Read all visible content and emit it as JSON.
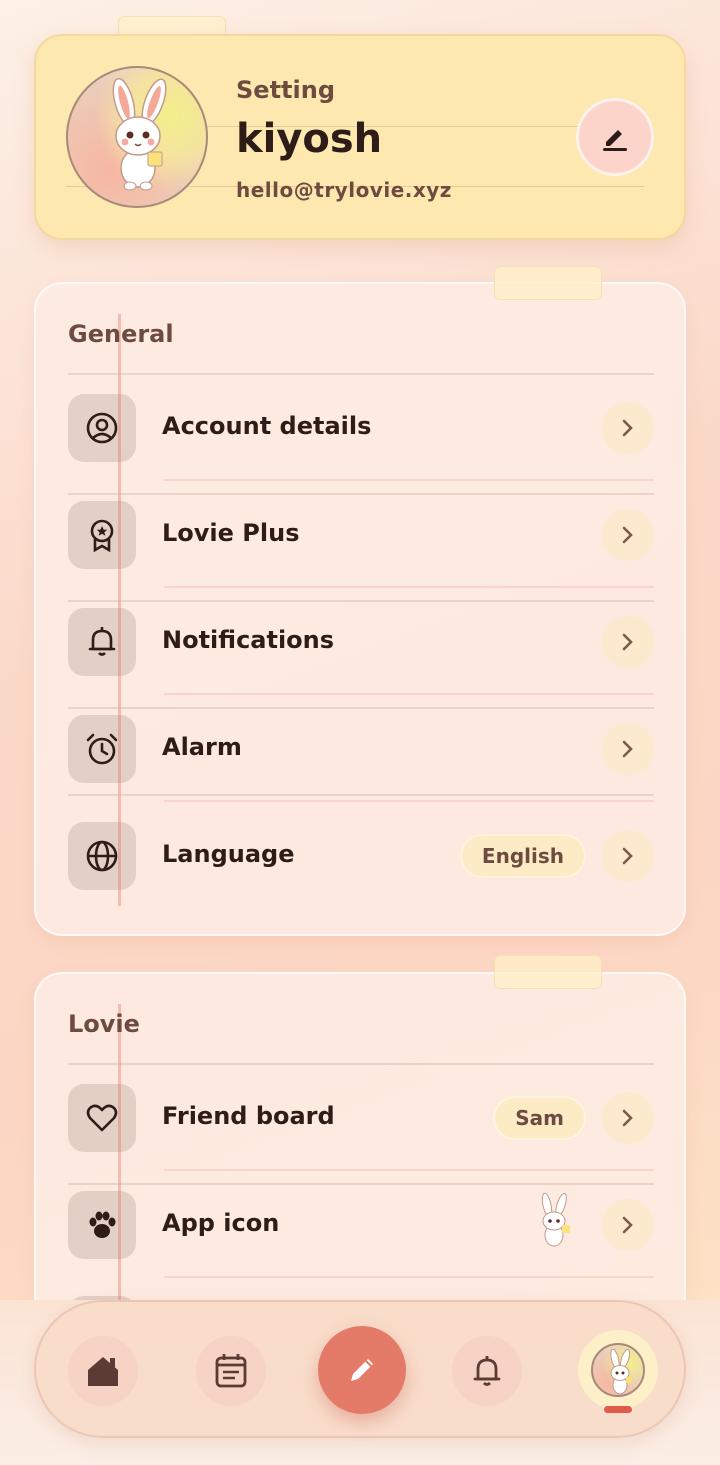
{
  "profile": {
    "subtitle": "Setting",
    "name": "kiyosh",
    "email": "hello@trylovie.xyz"
  },
  "general": {
    "title": "General",
    "items": [
      {
        "label": "Account details",
        "icon": "user-circle-icon"
      },
      {
        "label": "Lovie Plus",
        "icon": "award-ribbon-icon"
      },
      {
        "label": "Notifications",
        "icon": "bell-icon"
      },
      {
        "label": "Alarm",
        "icon": "alarm-clock-icon"
      },
      {
        "label": "Language",
        "icon": "globe-icon",
        "value": "English"
      }
    ]
  },
  "lovie": {
    "title": "Lovie",
    "items": [
      {
        "label": "Friend board",
        "icon": "heart-icon",
        "value": "Sam"
      },
      {
        "label": "App icon",
        "icon": "paw-icon",
        "value_icon": "bunny-app-icon"
      }
    ]
  },
  "nav": {
    "items": [
      "home-icon",
      "calendar-list-icon",
      "pencil-icon",
      "bell-icon",
      "profile-avatar"
    ],
    "active": "profile-avatar"
  },
  "colors": {
    "accent": "#e47a68",
    "profile_card": "#fde8b0",
    "text": "#2e1c18"
  }
}
